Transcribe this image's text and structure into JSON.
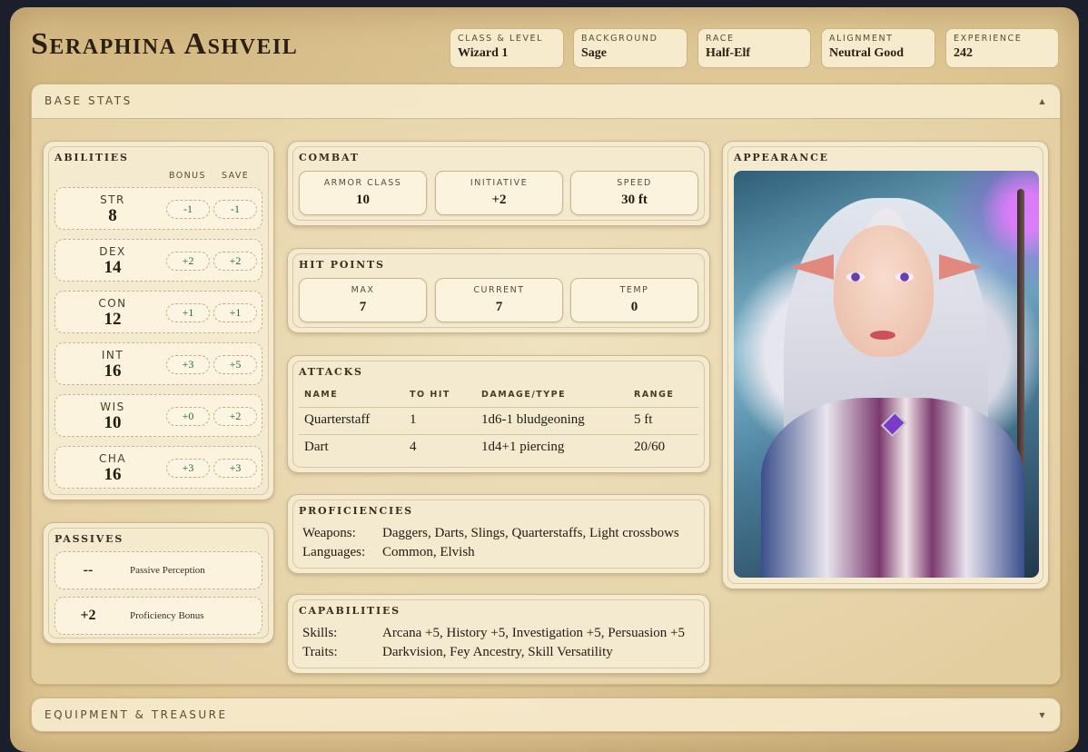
{
  "character": {
    "name": "Seraphina Ashveil"
  },
  "meta": [
    {
      "label": "Class & Level",
      "value": "Wizard 1"
    },
    {
      "label": "Background",
      "value": "Sage"
    },
    {
      "label": "Race",
      "value": "Half-Elf"
    },
    {
      "label": "Alignment",
      "value": "Neutral Good"
    },
    {
      "label": "Experience",
      "value": "242"
    }
  ],
  "sections": {
    "base_stats": {
      "title": "BASE STATS",
      "caret": "▲"
    },
    "equipment": {
      "title": "EQUIPMENT & TREASURE",
      "caret": "▼"
    }
  },
  "abilities": {
    "title": "Abilities",
    "bonus_header": "BONUS",
    "save_header": "SAVE",
    "items": [
      {
        "name": "STR",
        "score": "8",
        "bonus": "-1",
        "save": "-1"
      },
      {
        "name": "DEX",
        "score": "14",
        "bonus": "+2",
        "save": "+2"
      },
      {
        "name": "CON",
        "score": "12",
        "bonus": "+1",
        "save": "+1"
      },
      {
        "name": "INT",
        "score": "16",
        "bonus": "+3",
        "save": "+5"
      },
      {
        "name": "WIS",
        "score": "10",
        "bonus": "+0",
        "save": "+2"
      },
      {
        "name": "CHA",
        "score": "16",
        "bonus": "+3",
        "save": "+3"
      }
    ]
  },
  "passives": {
    "title": "Passives",
    "items": [
      {
        "value": "--",
        "label": "Passive Perception"
      },
      {
        "value": "+2",
        "label": "Proficiency Bonus"
      }
    ]
  },
  "combat": {
    "title": "Combat",
    "items": [
      {
        "label": "ARMOR CLASS",
        "value": "10"
      },
      {
        "label": "INITIATIVE",
        "value": "+2"
      },
      {
        "label": "SPEED",
        "value": "30 ft"
      }
    ]
  },
  "hit_points": {
    "title": "Hit Points",
    "items": [
      {
        "label": "MAX",
        "value": "7"
      },
      {
        "label": "CURRENT",
        "value": "7"
      },
      {
        "label": "TEMP",
        "value": "0"
      }
    ]
  },
  "attacks": {
    "title": "Attacks",
    "headers": [
      "NAME",
      "TO HIT",
      "DAMAGE/TYPE",
      "RANGE"
    ],
    "rows": [
      [
        "Quarterstaff",
        "1",
        "1d6-1 bludgeoning",
        "5 ft"
      ],
      [
        "Dart",
        "4",
        "1d4+1 piercing",
        "20/60"
      ]
    ]
  },
  "proficiencies": {
    "title": "Proficiencies",
    "items": [
      {
        "key": "Weapons:",
        "value": "Daggers, Darts, Slings, Quarterstaffs, Light crossbows"
      },
      {
        "key": "Languages:",
        "value": "Common, Elvish"
      }
    ]
  },
  "capabilities": {
    "title": "Capabilities",
    "items": [
      {
        "key": "Skills:",
        "value": "Arcana +5, History +5, Investigation +5, Persuasion +5"
      },
      {
        "key": "Traits:",
        "value": "Darkvision, Fey Ancestry, Skill Versatility"
      }
    ]
  },
  "appearance": {
    "title": "Appearance"
  },
  "colors": {
    "bonus_text": "#2c6a2c",
    "parchment": "#f4ead0",
    "border": "#cbb78e",
    "page_bg": "#1a1f2b"
  }
}
